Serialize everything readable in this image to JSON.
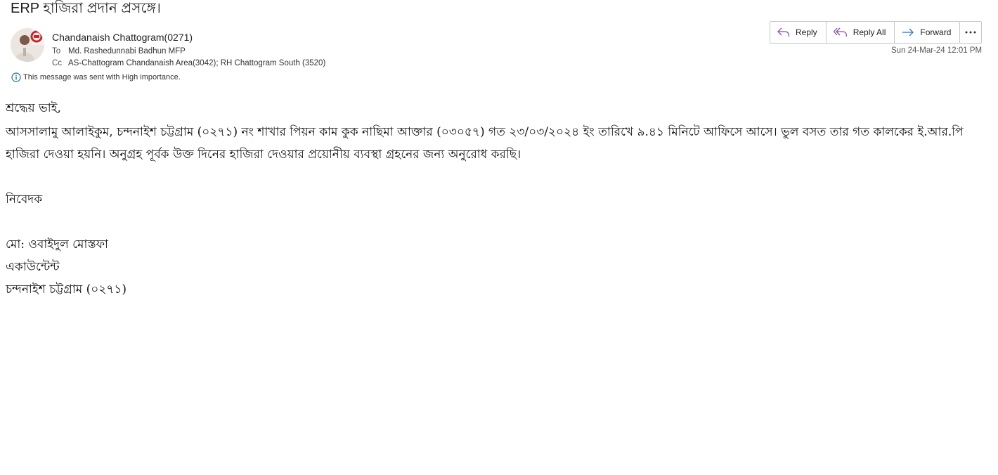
{
  "email": {
    "subject": "ERP হাজিরা প্রদান প্রসঙ্গে।",
    "sender": "Chandanaish  Chattogram(0271)",
    "to_label": "To",
    "to_value": "Md. Rashedunnabi Badhun MFP",
    "cc_label": "Cc",
    "cc_value": "AS-Chattogram Chandanaish Area(3042); RH Chattogram South (3520)",
    "importance_notice": "This message was sent with High importance.",
    "timestamp": "Sun 24-Mar-24 12:01 PM"
  },
  "actions": {
    "reply": "Reply",
    "reply_all": "Reply All",
    "forward": "Forward"
  },
  "icons": {
    "reply": "reply-icon",
    "reply_all": "reply-all-icon",
    "forward": "forward-icon",
    "more": "more-options-icon",
    "info": "info-icon"
  },
  "colors": {
    "reply_icon": "#8a4fa8",
    "forward_icon": "#2b73c9",
    "info_icon": "#1f6d9e"
  },
  "body": {
    "greeting": "শ্রদ্ধেয় ভাই,",
    "paragraph_line1": "আসসালামু আলাইকুম, চন্দনাইশ চট্টগ্রাম (০২৭১) নং শাখার পিয়ন কাম কুক নাছিমা আক্তার (০৩০৫৭) গত ২৩/০৩/২০২৪ ইং তারিখে ৯.৪১ মিনিটে আফিসে আসে। ভুল বসত তার গত কালকের  ই.আর.পি",
    "paragraph_line2": "হাজিরা দেওয়া হয়নি। অনুগ্রহ পূর্বক উক্ত দিনের হাজিরা দেওয়ার প্রয়োনীয় ব্যবস্থা গ্রহনের জন্য অনুরোধ করছি।",
    "closing": "নিবেদক",
    "signature_name": "মো: ওবাইদুল মোস্তফা",
    "signature_title": "একাউন্টেন্ট",
    "signature_branch": "চন্দনাইশ চট্টগ্রাম (০২৭১)"
  }
}
